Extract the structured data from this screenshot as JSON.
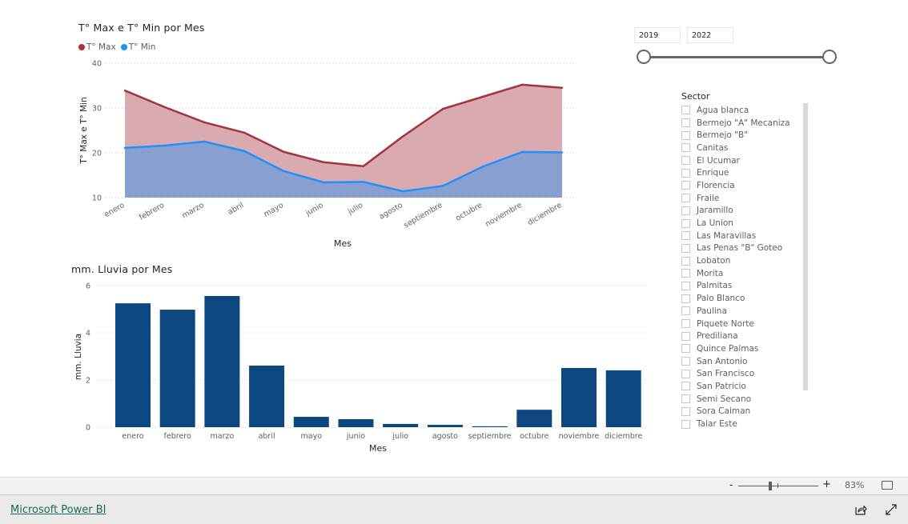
{
  "chart_data": [
    {
      "type": "area",
      "title": "T° Max e T° Min por Mes",
      "xlabel": "Mes",
      "ylabel": "T° Max e T° Min",
      "ylim": [
        10,
        40
      ],
      "yticks": [
        "10",
        "20",
        "30",
        "40"
      ],
      "ytick_values": [
        10,
        20,
        30,
        40
      ],
      "grid": true,
      "legend_position": "top-left",
      "categories": [
        "enero",
        "febrero",
        "marzo",
        "abril",
        "mayo",
        "junio",
        "julio",
        "agosto",
        "septiembre",
        "octubre",
        "noviembre",
        "diciembre"
      ],
      "series": [
        {
          "name": "T° Max",
          "color": "#a4343a",
          "fill": "#d9aab0",
          "values": [
            33.9,
            30.2,
            26.8,
            24.5,
            20.2,
            17.9,
            17.0,
            23.7,
            29.8,
            32.5,
            35.2,
            34.5
          ]
        },
        {
          "name": "T° Min",
          "color": "#1e90ff",
          "fill": "#889fd0",
          "values": [
            21.1,
            21.6,
            22.5,
            20.4,
            15.9,
            13.4,
            13.5,
            11.4,
            12.6,
            16.9,
            20.2,
            20.1
          ]
        }
      ]
    },
    {
      "type": "bar",
      "title": "mm. Lluvia por Mes",
      "xlabel": "Mes",
      "ylabel": "mm. Lluvia",
      "ylim": [
        0,
        6
      ],
      "yticks": [
        "0",
        "2",
        "4",
        "6"
      ],
      "ytick_values": [
        0,
        2,
        4,
        6
      ],
      "grid": true,
      "color": "#0c477f",
      "categories": [
        "enero",
        "febrero",
        "marzo",
        "abril",
        "mayo",
        "junio",
        "julio",
        "agosto",
        "septiembre",
        "octubre",
        "noviembre",
        "diciembre"
      ],
      "values": [
        5.25,
        4.98,
        5.56,
        2.61,
        0.44,
        0.34,
        0.14,
        0.1,
        0.04,
        0.74,
        2.51,
        2.41
      ]
    }
  ],
  "year_slicer": {
    "start": "2019",
    "end": "2022",
    "start_fraction": 0,
    "end_fraction": 1
  },
  "sector_slicer": {
    "title": "Sector",
    "items": [
      "Agua blanca",
      "Bermejo \"A\" Mecaniza",
      "Bermejo \"B\"",
      "Canitas",
      "El Ucumar",
      "Enrique",
      "Florencia",
      "Fraile",
      "Jaramillo",
      "La Union",
      "Las Maravillas",
      "Las Penas \"B\" Goteo",
      "Lobaton",
      "Morita",
      "Palmitas",
      "Palo Blanco",
      "Paulina",
      "Piquete Norte",
      "Prediliana",
      "Quince Palmas",
      "San Antonio",
      "San Francisco",
      "San Patricio",
      "Semi Secano",
      "Sora Caiman",
      "Talar Este"
    ]
  },
  "zoom": {
    "minus": "-",
    "plus": "+",
    "level": "83%"
  },
  "footer": {
    "link": "Microsoft Power BI"
  },
  "icons": {
    "fit": "fit-to-page-icon",
    "share": "share-icon",
    "expand": "fullscreen-icon"
  }
}
